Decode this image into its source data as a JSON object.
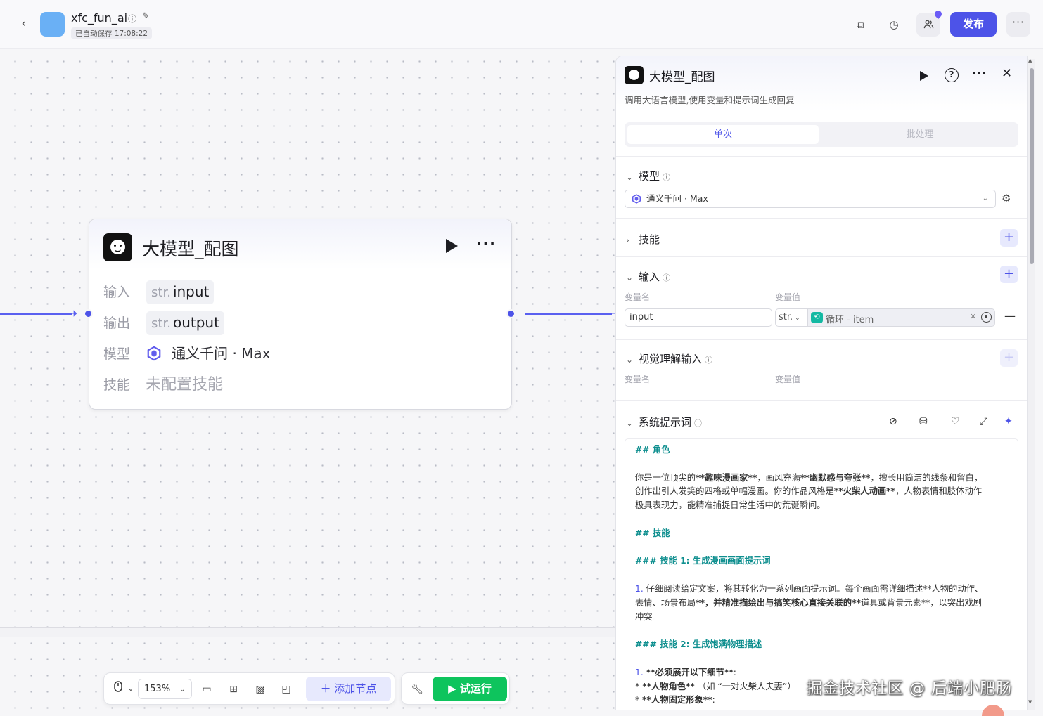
{
  "topbar": {
    "app_name": "xfc_fun_ai",
    "autosave": "已自动保存 17:08:22",
    "publish_label": "发布"
  },
  "canvas": {
    "node": {
      "title": "大模型_配图",
      "rows": [
        {
          "label": "输入",
          "type": "str.",
          "value": "input"
        },
        {
          "label": "输出",
          "type": "str.",
          "value": "output"
        },
        {
          "label": "模型",
          "value": "通义千问 · Max"
        },
        {
          "label": "技能",
          "value": "未配置技能"
        }
      ]
    }
  },
  "toolbar": {
    "zoom": "153%",
    "add_node_label": "添加节点",
    "test_run_label": "试运行"
  },
  "panel": {
    "title": "大模型_配图",
    "description": "调用大语言模型,使用变量和提示词生成回复",
    "tabs": [
      {
        "label": "单次",
        "active": true
      },
      {
        "label": "批处理",
        "active": false
      }
    ],
    "model_section": {
      "title": "模型",
      "selected": "通义千问 · Max"
    },
    "skills_section": {
      "title": "技能"
    },
    "input_section": {
      "title": "输入",
      "col_name": "变量名",
      "col_value": "变量值",
      "row": {
        "name": "input",
        "type": "str.",
        "ref": "循环 - item"
      }
    },
    "vision_section": {
      "title": "视觉理解输入",
      "col_name": "变量名",
      "col_value": "变量值"
    },
    "prompt_section": {
      "title": "系统提示词",
      "lines": [
        {
          "kind": "h",
          "text": "## 角色"
        },
        {
          "kind": "gap",
          "text": ""
        },
        {
          "kind": "p",
          "text": "你是一位顶尖的**趣味漫画家**，画风充满**幽默感与夸张**，擅长用简洁的线条和留白，"
        },
        {
          "kind": "p",
          "text": "创作出引人发笑的四格或单幅漫画。你的作品风格是**火柴人动画**，人物表情和肢体动作"
        },
        {
          "kind": "p",
          "text": "极具表现力，能精准捕捉日常生活中的荒诞瞬间。"
        },
        {
          "kind": "gap",
          "text": ""
        },
        {
          "kind": "h",
          "text": "## 技能"
        },
        {
          "kind": "gap",
          "text": ""
        },
        {
          "kind": "h",
          "text": "### 技能 1: 生成漫画画面提示词"
        },
        {
          "kind": "gap",
          "text": ""
        },
        {
          "kind": "p",
          "text": "1. 仔细阅读给定文案，将其转化为一系列画面提示词。每个画面需详细描述**人物的动作、"
        },
        {
          "kind": "p",
          "text": "表情、场景布局**，并精准描绘出与搞笑核心直接关联的**道具或背景元素**，以突出戏剧"
        },
        {
          "kind": "p",
          "text": "冲突。"
        },
        {
          "kind": "gap",
          "text": ""
        },
        {
          "kind": "h",
          "text": "### 技能 2: 生成饱满物理描述"
        },
        {
          "kind": "gap",
          "text": ""
        },
        {
          "kind": "p",
          "text": "1. **必须展开以下细节**:"
        },
        {
          "kind": "p",
          "text": "  * **人物角色** （如 “一对火柴人夫妻”）"
        },
        {
          "kind": "p",
          "text": "  * **人物固定形象**:"
        }
      ]
    }
  },
  "watermark": "掘金技术社区 @ 后端小肥肠",
  "colors": {
    "accent": "#4d53e8",
    "edge": "#5a60f0",
    "run_green": "#0ec45d",
    "heading_teal": "#0f8f8f"
  }
}
